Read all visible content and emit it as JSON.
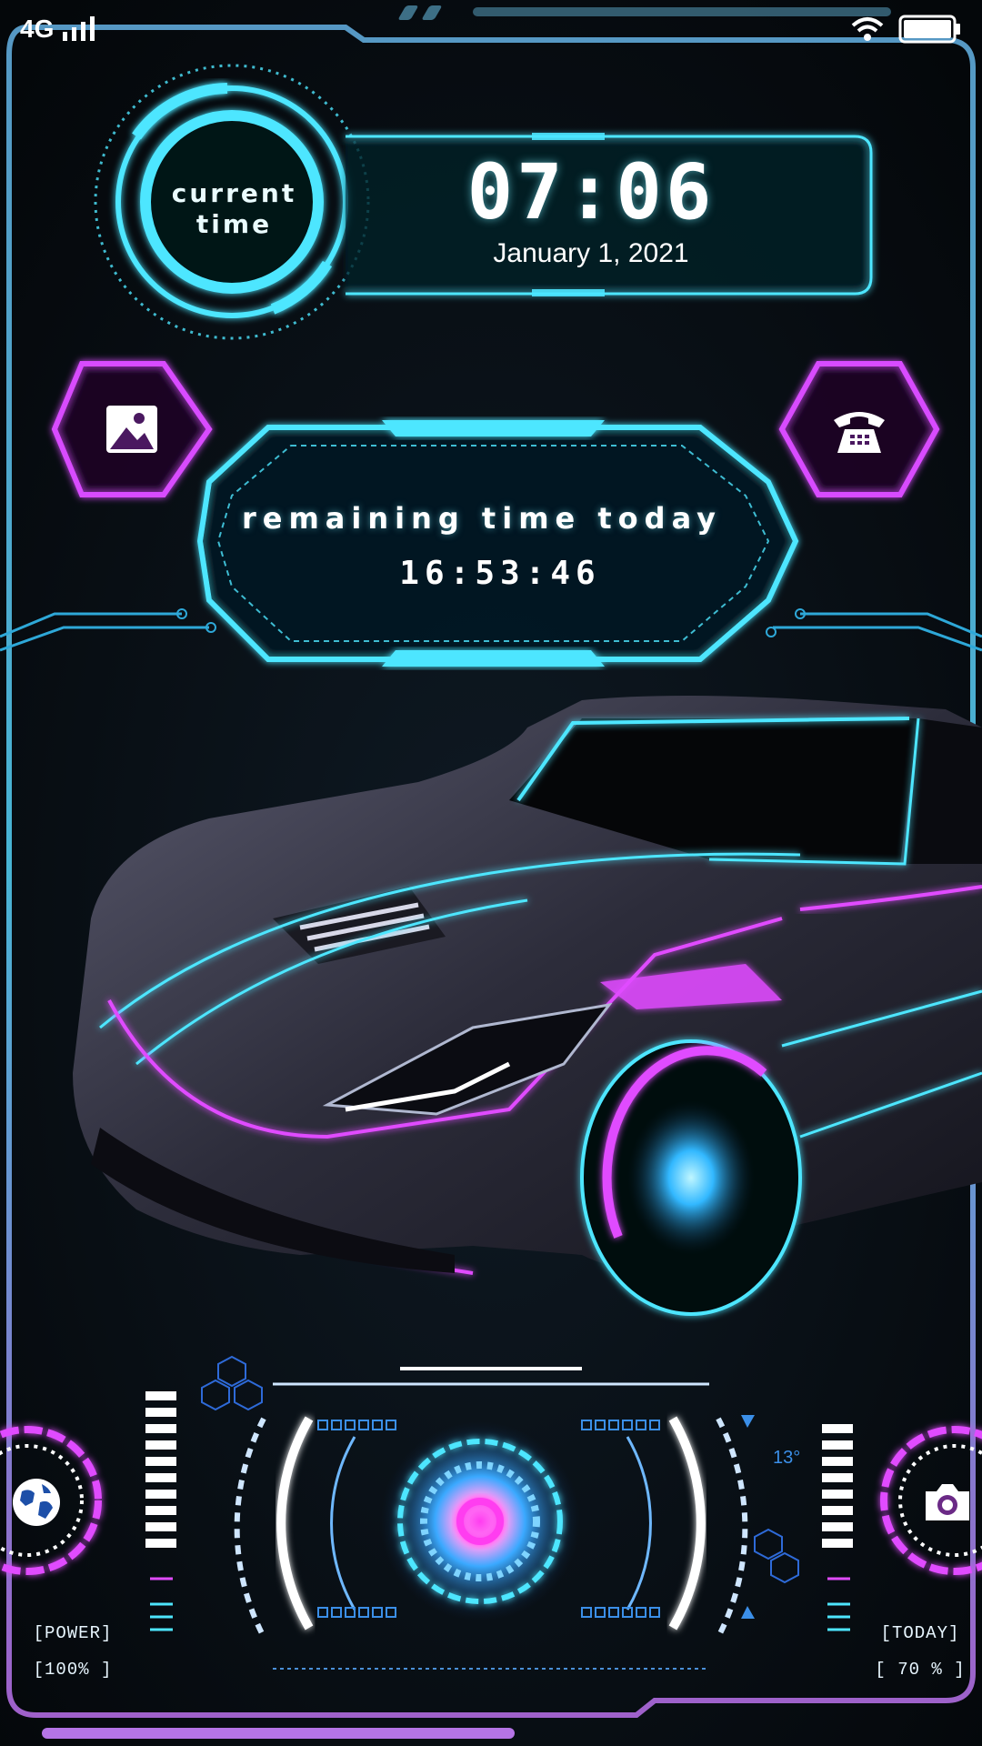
{
  "status_bar": {
    "network": "4G",
    "signal_icon": "signal-bars-icon",
    "wifi_icon": "wifi-icon",
    "battery_icon": "battery-icon"
  },
  "clock_panel": {
    "ring_label": "current time",
    "time": "07:06",
    "date": "January 1, 2021"
  },
  "shortcuts": {
    "gallery_icon": "image-icon",
    "phone_icon": "telephone-icon",
    "globe_icon": "globe-icon",
    "camera_icon": "camera-icon"
  },
  "countdown": {
    "label": "remaining time today",
    "value": "16:53:46"
  },
  "dashboard": {
    "power_label": "[POWER]",
    "power_value": "[100% ]",
    "today_label": "[TODAY]",
    "today_value": "[ 70 % ]",
    "temperature": "13°"
  },
  "colors": {
    "cyan": "#4de6ff",
    "magenta": "#e04bff",
    "blue": "#2e7bff",
    "background": "#05080c"
  }
}
